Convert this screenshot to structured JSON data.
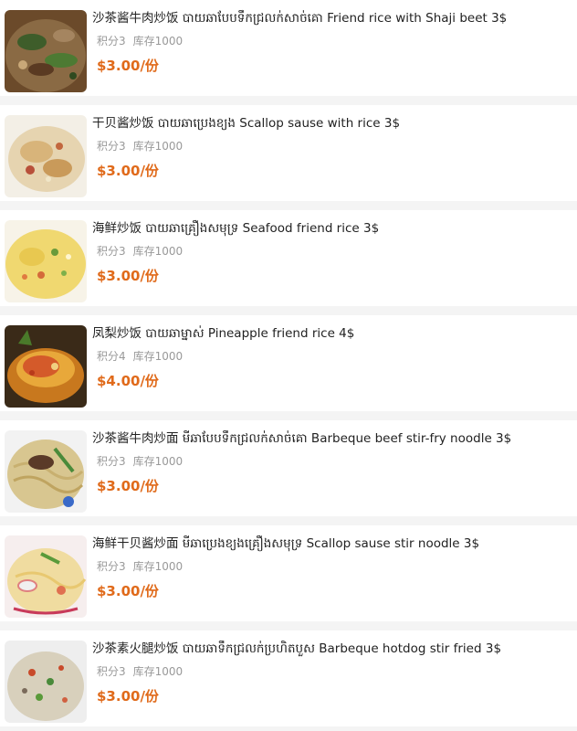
{
  "theme": {
    "price_color": "#e06a1a",
    "background": "#f4f4f4",
    "card_background": "#ffffff"
  },
  "items": [
    {
      "title": "沙茶酱牛肉炒饭 បាយឆាបែបទឹកជ្រលក់សាច់គោ Friend rice with Shaji beet 3$",
      "points_label": "积分3",
      "stock_label": "库存1000",
      "price": "$3.00/份",
      "image_icon": "fried-rice-beef-photo"
    },
    {
      "title": "干贝酱炒饭 បាយឆាប្រេងខ្យង Scallop sause with rice 3$",
      "points_label": "积分3",
      "stock_label": "库存1000",
      "price": "$3.00/份",
      "image_icon": "scallop-fried-rice-photo"
    },
    {
      "title": "海鲜炒饭 បាយឆាគ្រឿងសមុទ្រ Seafood friend rice 3$",
      "points_label": "积分3",
      "stock_label": "库存1000",
      "price": "$3.00/份",
      "image_icon": "seafood-fried-rice-photo"
    },
    {
      "title": "凤梨炒饭 បាយឆាម្នាស់ Pineapple friend rice 4$",
      "points_label": "积分4",
      "stock_label": "库存1000",
      "price": "$4.00/份",
      "image_icon": "pineapple-fried-rice-photo"
    },
    {
      "title": "沙茶酱牛肉炒面 មីឆាបែបទឹកជ្រលក់សាច់គោ Barbeque beef stir-fry noodle 3$",
      "points_label": "积分3",
      "stock_label": "库存1000",
      "price": "$3.00/份",
      "image_icon": "beef-noodle-photo"
    },
    {
      "title": "海鲜干贝酱炒面 មីឆាប្រេងខ្យងគ្រឿងសមុទ្រ Scallop sause stir noodle 3$",
      "points_label": "积分3",
      "stock_label": "库存1000",
      "price": "$3.00/份",
      "image_icon": "seafood-noodle-photo"
    },
    {
      "title": "沙茶素火腿炒饭 បាយឆាទឹកជ្រលក់ប្រហិតបួស Barbeque hotdog stir fried 3$",
      "points_label": "积分3",
      "stock_label": "库存1000",
      "price": "$3.00/份",
      "image_icon": "hotdog-fried-rice-photo"
    }
  ]
}
